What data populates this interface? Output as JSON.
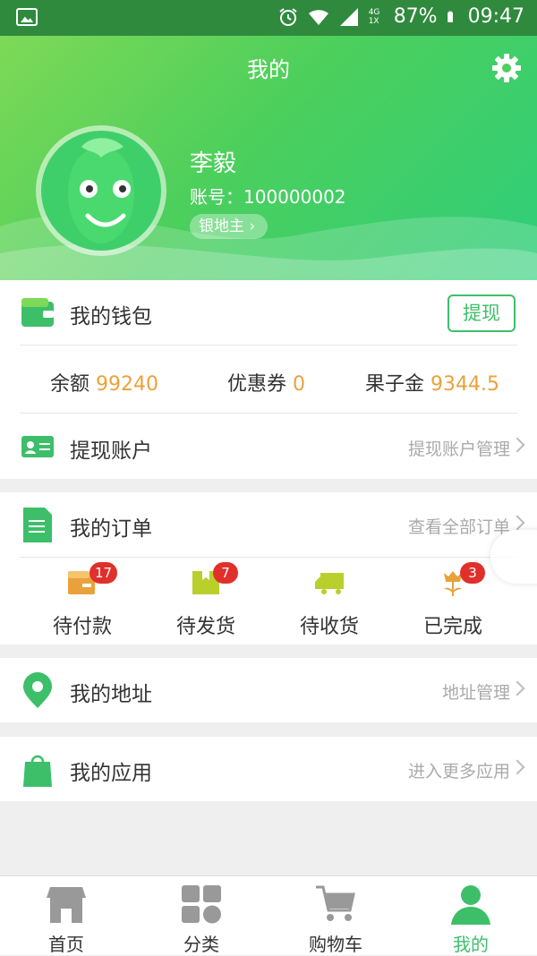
{
  "status_bar": {
    "battery": "87%",
    "time": "09:47",
    "network": "4G 1X"
  },
  "header": {
    "title": "我的"
  },
  "user": {
    "name": "李毅",
    "account": "账号：100000002",
    "level": "银地主"
  },
  "wallet": {
    "label": "我的钱包",
    "withdraw_button": "提现",
    "balance_label": "余额",
    "balance_value": "99240",
    "coupon_label": "优惠券",
    "coupon_value": "0",
    "gold_label": "果子金",
    "gold_value": "9344.5"
  },
  "withdraw_account": {
    "label": "提现账户",
    "link": "提现账户管理"
  },
  "orders": {
    "label": "我的订单",
    "link": "查看全部订单",
    "items": [
      {
        "label": "待付款",
        "badge": "17"
      },
      {
        "label": "待发货",
        "badge": "7"
      },
      {
        "label": "待收货",
        "badge": ""
      },
      {
        "label": "已完成",
        "badge": "3"
      }
    ]
  },
  "address": {
    "label": "我的地址",
    "link": "地址管理"
  },
  "apps": {
    "label": "我的应用",
    "link": "进入更多应用"
  },
  "tabbar": {
    "items": [
      {
        "label": "首页",
        "icon": "shop-icon"
      },
      {
        "label": "分类",
        "icon": "category-icon"
      },
      {
        "label": "购物车",
        "icon": "cart-icon"
      },
      {
        "label": "我的",
        "icon": "user-icon"
      }
    ]
  },
  "colors": {
    "accent": "#3dbf6a",
    "value": "#e9a23b",
    "badge": "#e0302b"
  }
}
